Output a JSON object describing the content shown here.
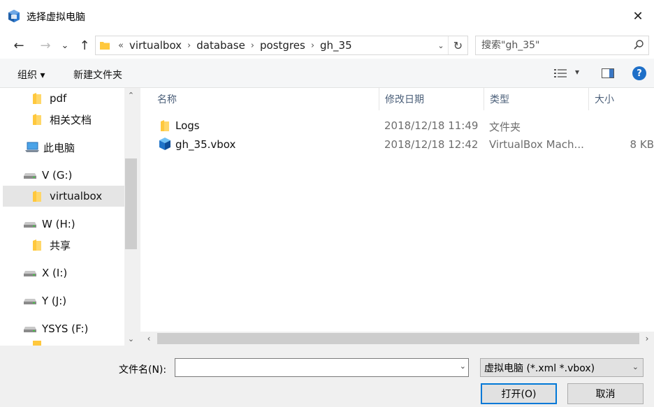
{
  "window": {
    "title": "选择虚拟电脑",
    "close_glyph": "✕"
  },
  "nav": {
    "back_glyph": "←",
    "forward_glyph": "→",
    "recent_glyph": "⌄",
    "up_glyph": "↑",
    "overflow_glyph": "«",
    "separator": "›",
    "breadcrumbs": [
      "virtualbox",
      "database",
      "postgres",
      "gh_35"
    ],
    "dropdown_glyph": "⌄",
    "refresh_glyph": "↻",
    "search_placeholder": "搜索\"gh_35\""
  },
  "toolbar": {
    "organize_label": "组织 ▾",
    "new_folder_label": "新建文件夹",
    "view_dd_glyph": "▾",
    "help_glyph": "?"
  },
  "sidebar": {
    "items": [
      {
        "label": "pdf",
        "icon": "folder-icon"
      },
      {
        "label": "相关文档",
        "icon": "folder-icon"
      },
      {
        "label": "此电脑",
        "icon": "computer-icon"
      },
      {
        "label": "V (G:)",
        "icon": "drive-icon"
      },
      {
        "label": "virtualbox",
        "icon": "folder-icon",
        "selected": true
      },
      {
        "label": "W (H:)",
        "icon": "drive-icon"
      },
      {
        "label": "共享",
        "icon": "folder-icon"
      },
      {
        "label": "X (I:)",
        "icon": "drive-icon"
      },
      {
        "label": "Y (J:)",
        "icon": "drive-icon"
      },
      {
        "label": "YSYS (F:)",
        "icon": "drive-icon"
      }
    ],
    "scroll_up": "⌃",
    "scroll_down": "⌄"
  },
  "columns": {
    "name": "名称",
    "modified": "修改日期",
    "type": "类型",
    "size": "大小",
    "sort_glyph": "^"
  },
  "files": [
    {
      "name": "Logs",
      "modified": "2018/12/18 11:49",
      "type": "文件夹",
      "size": "",
      "icon": "folder-icon"
    },
    {
      "name": "gh_35.vbox",
      "modified": "2018/12/18 12:42",
      "type": "VirtualBox Mach...",
      "size": "8 KB",
      "icon": "vbox-file-icon"
    }
  ],
  "hscroll": {
    "left": "‹",
    "right": "›"
  },
  "footer": {
    "filename_label": "文件名(N):",
    "filename_value": "",
    "filename_dd": "⌄",
    "filter_value": "虚拟电脑 (*.xml *.vbox)",
    "filter_dd": "⌄",
    "open_label": "打开(O)",
    "cancel_label": "取消"
  },
  "colors": {
    "accent": "#0078d7",
    "folder": "#ffc83d",
    "selected_bg": "#e5e5e5",
    "header_text": "#4c607a"
  }
}
